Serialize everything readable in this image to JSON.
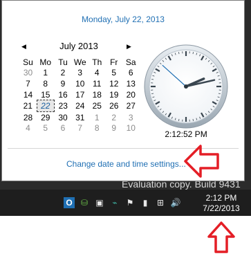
{
  "popup": {
    "long_date": "Monday, July 22, 2013",
    "calendar": {
      "prev_arrow": "◀",
      "next_arrow": "▶",
      "month_title": "July 2013",
      "weekdays": [
        "Su",
        "Mo",
        "Tu",
        "We",
        "Th",
        "Fr",
        "Sa"
      ],
      "weeks": [
        [
          {
            "d": "30",
            "o": true
          },
          {
            "d": "1"
          },
          {
            "d": "2"
          },
          {
            "d": "3"
          },
          {
            "d": "4"
          },
          {
            "d": "5"
          },
          {
            "d": "6"
          }
        ],
        [
          {
            "d": "7"
          },
          {
            "d": "8"
          },
          {
            "d": "9"
          },
          {
            "d": "10"
          },
          {
            "d": "11"
          },
          {
            "d": "12"
          },
          {
            "d": "13"
          }
        ],
        [
          {
            "d": "14"
          },
          {
            "d": "15"
          },
          {
            "d": "16"
          },
          {
            "d": "17"
          },
          {
            "d": "18"
          },
          {
            "d": "19"
          },
          {
            "d": "20"
          }
        ],
        [
          {
            "d": "21"
          },
          {
            "d": "22",
            "t": true
          },
          {
            "d": "23"
          },
          {
            "d": "24"
          },
          {
            "d": "25"
          },
          {
            "d": "26"
          },
          {
            "d": "27"
          }
        ],
        [
          {
            "d": "28"
          },
          {
            "d": "29"
          },
          {
            "d": "30"
          },
          {
            "d": "31"
          },
          {
            "d": "1",
            "o": true
          },
          {
            "d": "2",
            "o": true
          },
          {
            "d": "3",
            "o": true
          }
        ],
        [
          {
            "d": "4",
            "o": true
          },
          {
            "d": "5",
            "o": true
          },
          {
            "d": "6",
            "o": true
          },
          {
            "d": "7",
            "o": true
          },
          {
            "d": "8",
            "o": true
          },
          {
            "d": "9",
            "o": true
          },
          {
            "d": "10",
            "o": true
          }
        ]
      ]
    },
    "clock": {
      "hour": 2,
      "minute": 12,
      "second": 52,
      "digital_time": "2:12:52 PM"
    },
    "change_link": "Change date and time settings..."
  },
  "desktop": {
    "watermark_text": "Evaluation copy. Build 9431"
  },
  "taskbar": {
    "tray_icons": [
      {
        "name": "outlook-icon",
        "glyph": "O"
      },
      {
        "name": "network-share-icon",
        "glyph": "⛁"
      },
      {
        "name": "media-icon",
        "glyph": "▣"
      },
      {
        "name": "app-tray-icon",
        "glyph": "⌁"
      },
      {
        "name": "flag-icon",
        "glyph": "⚑"
      },
      {
        "name": "battery-icon",
        "glyph": "▮"
      },
      {
        "name": "network-icon",
        "glyph": "⊞"
      },
      {
        "name": "volume-icon",
        "glyph": "🔊"
      }
    ],
    "time": "2:12 PM",
    "date": "7/22/2013"
  },
  "colors": {
    "link_blue": "#1f6fb3",
    "callout_red": "#e41e26"
  }
}
